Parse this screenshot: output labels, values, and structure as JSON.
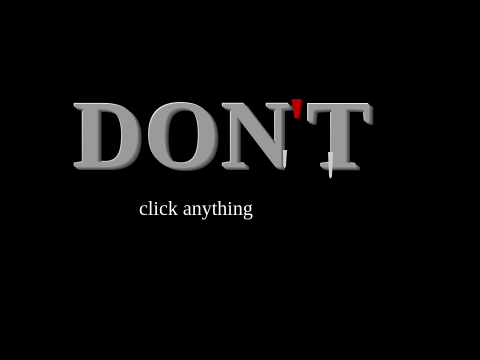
{
  "screen": {
    "background_color": "#000000",
    "headline": {
      "letters": [
        "D",
        "O",
        "N",
        "'",
        "T"
      ],
      "text": "DON'T",
      "face_color": "#d8d8d8",
      "apostrophe_color": "#b30000"
    },
    "subtitle": "click anything"
  }
}
